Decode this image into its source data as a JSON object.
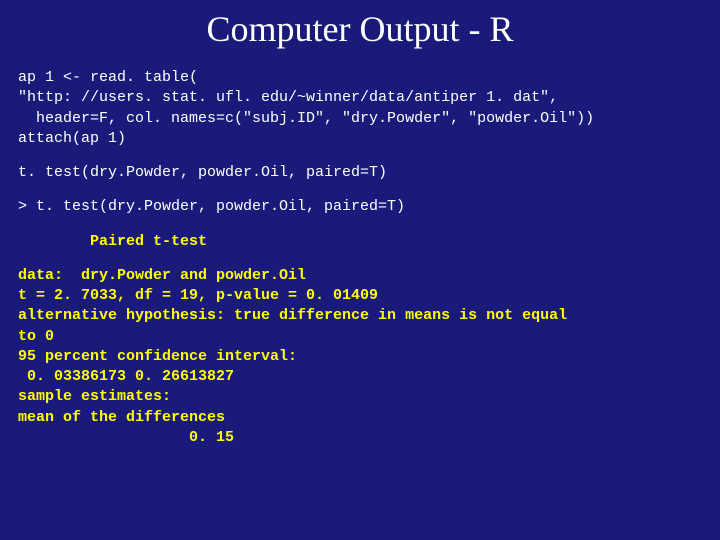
{
  "title": "Computer Output - R",
  "block1": "ap 1 <- read. table(\n\"http: //users. stat. ufl. edu/~winner/data/antiper 1. dat\",\n  header=F, col. names=c(\"subj.ID\", \"dry.Powder\", \"powder.Oil\"))\nattach(ap 1)",
  "block2": "t. test(dry.Powder, powder.Oil, paired=T)",
  "block3": "> t. test(dry.Powder, powder.Oil, paired=T)",
  "block4": "        Paired t-test",
  "block5": "data:  dry.Powder and powder.Oil\nt = 2. 7033, df = 19, p-value = 0. 01409\nalternative hypothesis: true difference in means is not equal\nto 0\n95 percent confidence interval:\n 0. 03386173 0. 26613827\nsample estimates:\nmean of the differences\n                   0. 15"
}
